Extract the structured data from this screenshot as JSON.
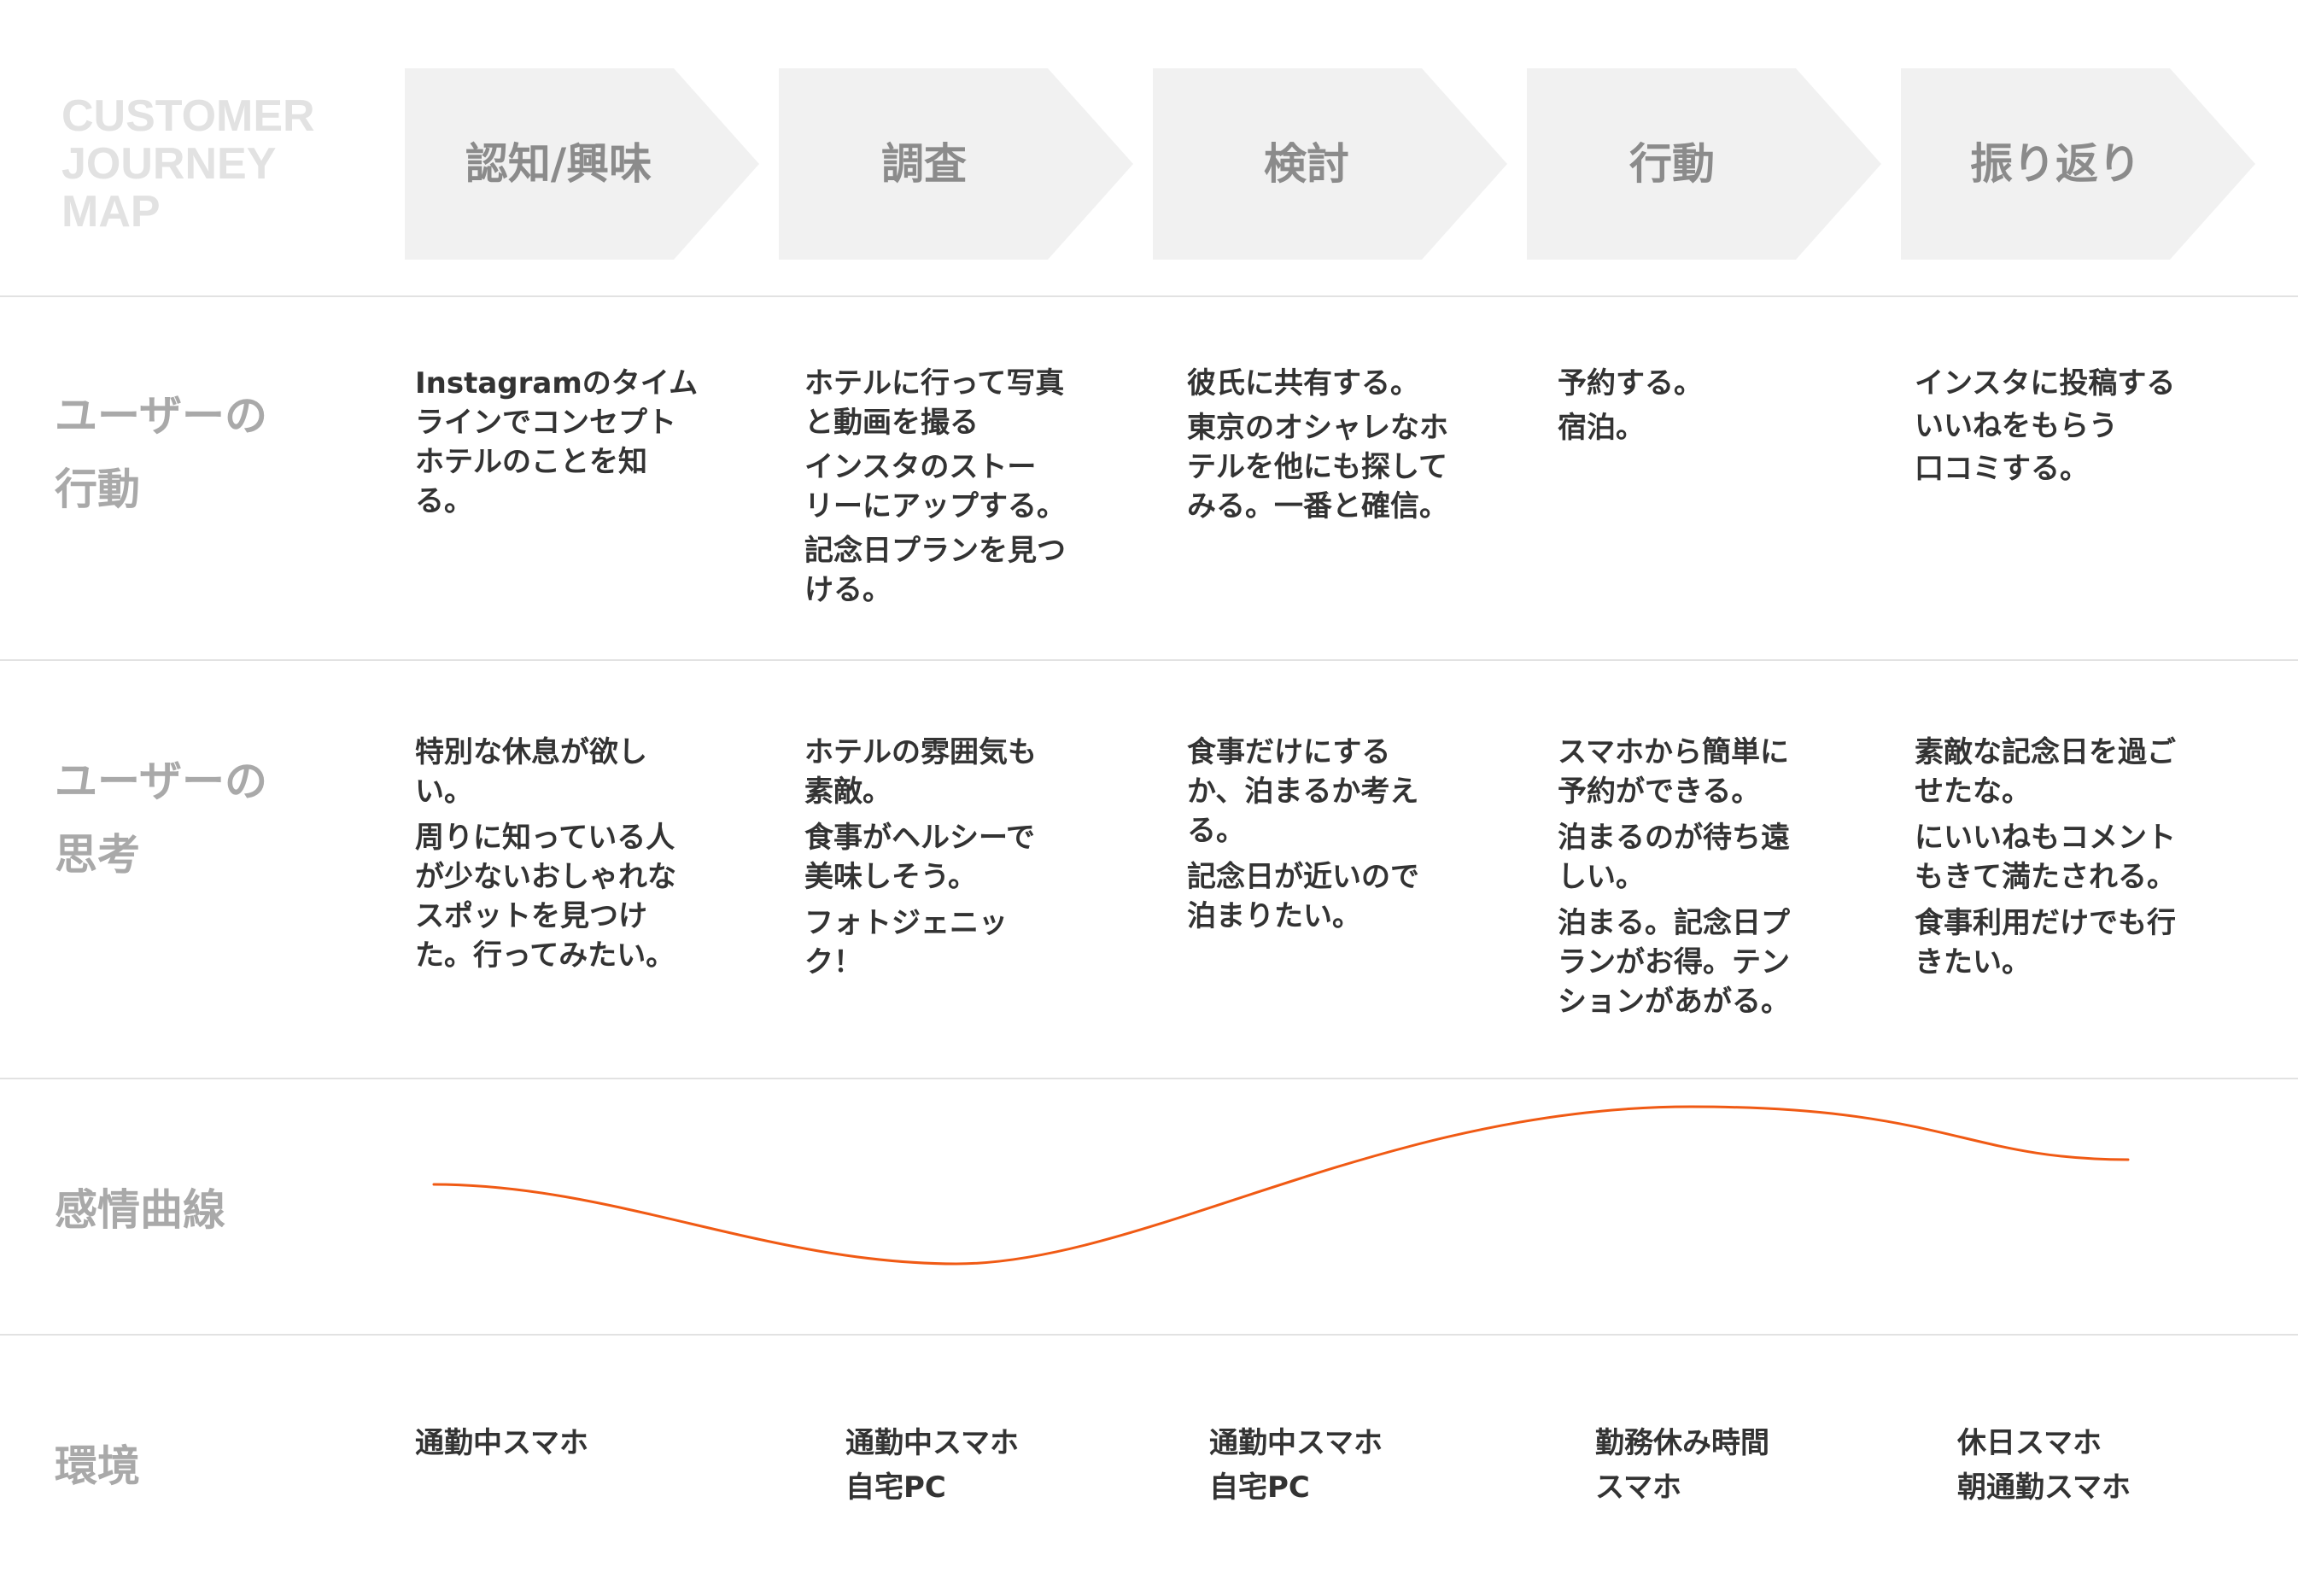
{
  "title": {
    "line1": "CUSTOMER",
    "line2": "JOURNEY",
    "line3": "MAP"
  },
  "stages": [
    "認知/興味",
    "調査",
    "検討",
    "行動",
    "振り返り"
  ],
  "rows": {
    "actions": {
      "label_line1": "ユーザーの",
      "label_line2": "行動",
      "cells": [
        [
          "Instagramのタイム\nラインでコンセプト\nホテルのことを知\nる。"
        ],
        [
          "ホテルに行って写真\nと動画を撮る",
          "インスタのストー\nリーにアップする。",
          "記念日プランを見つ\nける。"
        ],
        [
          "彼氏に共有する。",
          "東京のオシャレなホ\nテルを他にも探して\nみる。一番と確信。"
        ],
        [
          "予約する。",
          "宿泊。"
        ],
        [
          "インスタに投稿する",
          "いいねをもらう",
          "口コミする。"
        ]
      ]
    },
    "thoughts": {
      "label_line1": "ユーザーの",
      "label_line2": "思考",
      "cells": [
        [
          "特別な休息が欲し\nい。",
          "周りに知っている人\nが少ないおしゃれな\nスポットを見つけ\nた。行ってみたい。"
        ],
        [
          "ホテルの雰囲気も\n素敵。",
          "食事がヘルシーで\n美味しそう。",
          "フォトジェニッ\nク！"
        ],
        [
          "食事だけにする\nか、泊まるか考え\nる。",
          "記念日が近いので\n泊まりたい。"
        ],
        [
          "スマホから簡単に\n予約ができる。",
          "泊まるのが待ち遠\nしい。",
          "泊まる。記念日プ\nランがお得。テン\nションがあがる。"
        ],
        [
          "素敵な記念日を過ご\nせたな。",
          "にいいねもコメント\nもきて満たされる。",
          "食事利用だけでも行\nきたい。"
        ]
      ]
    },
    "emotion": {
      "label": "感情曲線",
      "curve_color": "#f05a14"
    },
    "environment": {
      "label": "環境",
      "cells": [
        [
          "通勤中スマホ"
        ],
        [
          "通勤中スマホ",
          "自宅PC"
        ],
        [
          "通勤中スマホ",
          "自宅PC"
        ],
        [
          "勤務休み時間",
          "スマホ"
        ],
        [
          "休日スマホ",
          "朝通勤スマホ"
        ]
      ]
    }
  },
  "colors": {
    "stage_bg": "#f1f1f1",
    "stage_text": "#8b8b8b",
    "title_text": "#e2e2e2",
    "label_text": "#a9a9a9",
    "divider": "#e2e2e2",
    "body_text": "#333333",
    "curve": "#f05a14"
  }
}
